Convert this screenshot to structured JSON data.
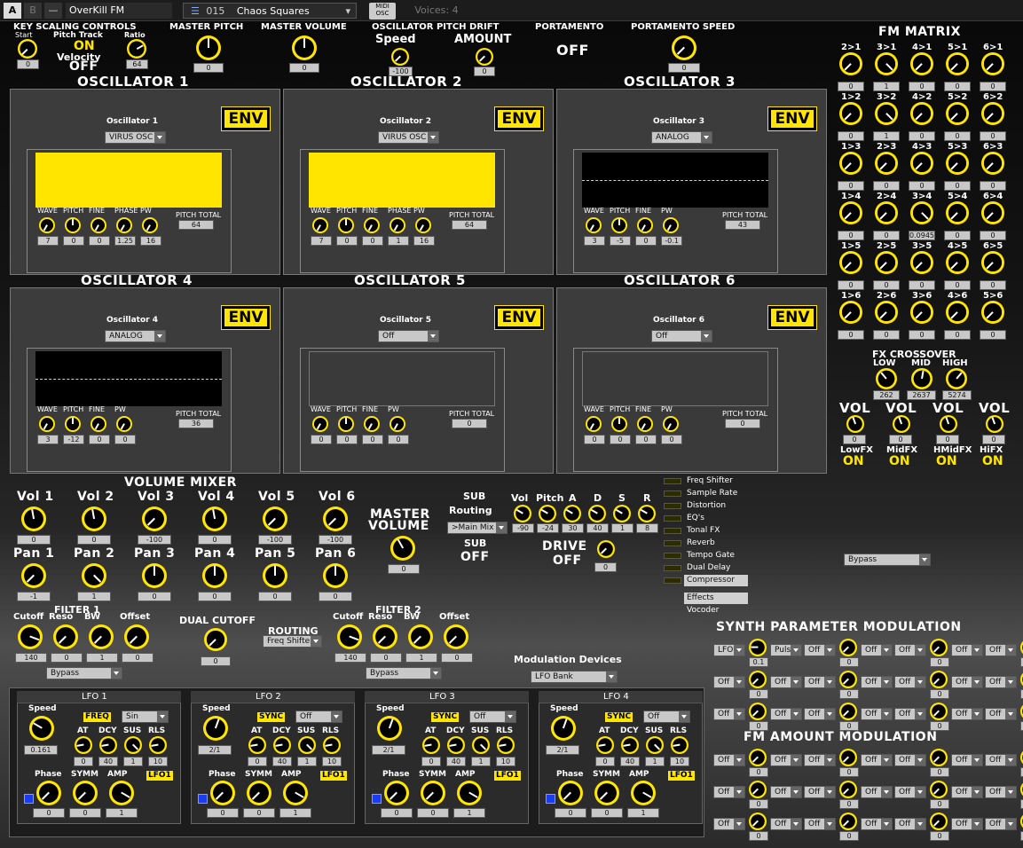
{
  "topbar": {
    "tab_a": "A",
    "tab_b": "B",
    "minus": "—",
    "plugin": "OverKill FM",
    "preset_num": "015",
    "preset_name": "Chaos Squares",
    "midi": "MIDI",
    "osc": "OSC",
    "voices": "Voices: 4"
  },
  "header": {
    "key_scaling": "KEY SCALING CONTROLS",
    "start": "Start",
    "pitch_track": "Pitch Track",
    "ratio": "Ratio",
    "on": "ON",
    "velocity": "Velocity",
    "off": "OFF",
    "start_val": "0",
    "ratio_val": "64",
    "master_pitch": "MASTER PITCH",
    "master_pitch_val": "0",
    "master_volume": "MASTER VOLUME",
    "master_volume_val": "0",
    "drift": "OSCILLATOR PITCH DRIFT",
    "speed": "Speed",
    "amount": "AMOUNT",
    "speed_val": "-100",
    "amount_val": "0",
    "portamento": "PORTAMENTO",
    "portamento_state": "OFF",
    "porta_speed": "PORTAMENTO SPEED",
    "porta_speed_val": "0"
  },
  "osc_labels": {
    "wave": "WAVE",
    "pitch": "PITCH",
    "fine": "FINE",
    "phase": "PHASE",
    "pw": "PW",
    "pitch_total": "PITCH TOTAL",
    "env": "ENV"
  },
  "oscillators": [
    {
      "title": "OSCILLATOR 1",
      "sub": "Oscillator 1",
      "type": "VIRUS OSC",
      "wave": "7",
      "pitch": "0",
      "fine": "0",
      "phase": "1.25",
      "pw": "16",
      "total": "64"
    },
    {
      "title": "OSCILLATOR 2",
      "sub": "Oscillator 2",
      "type": "VIRUS OSC",
      "wave": "7",
      "pitch": "0",
      "fine": "0",
      "phase": "1",
      "pw": "16",
      "total": "64"
    },
    {
      "title": "OSCILLATOR 3",
      "sub": "Oscillator 3",
      "type": "ANALOG",
      "wave": "3",
      "pitch": "-5",
      "fine": "0",
      "pw": "-0.1",
      "total": "43"
    },
    {
      "title": "OSCILLATOR 4",
      "sub": "Oscillator 4",
      "type": "ANALOG",
      "wave": "3",
      "pitch": "-12",
      "fine": "0",
      "pw": "0",
      "total": "36"
    },
    {
      "title": "OSCILLATOR 5",
      "sub": "Oscillator 5",
      "type": "Off",
      "wave": "0",
      "pitch": "0",
      "fine": "0",
      "pw": "0",
      "total": "0"
    },
    {
      "title": "OSCILLATOR 6",
      "sub": "Oscillator 6",
      "type": "Off",
      "wave": "0",
      "pitch": "0",
      "fine": "0",
      "pw": "0",
      "total": "0"
    }
  ],
  "fm_matrix": {
    "title": "FM MATRIX",
    "rows": [
      [
        [
          "2>1",
          "0"
        ],
        [
          "3>1",
          "1"
        ],
        [
          "4>1",
          "0"
        ],
        [
          "5>1",
          "0"
        ],
        [
          "6>1",
          "0"
        ]
      ],
      [
        [
          "1>2",
          "0"
        ],
        [
          "3>2",
          "1"
        ],
        [
          "4>2",
          "0"
        ],
        [
          "5>2",
          "0"
        ],
        [
          "6>2",
          "0"
        ]
      ],
      [
        [
          "1>3",
          "0"
        ],
        [
          "2>3",
          "0"
        ],
        [
          "4>3",
          "0"
        ],
        [
          "5>3",
          "0"
        ],
        [
          "6>3",
          "0"
        ]
      ],
      [
        [
          "1>4",
          "0"
        ],
        [
          "2>4",
          "0"
        ],
        [
          "3>4",
          "0.0945"
        ],
        [
          "5>4",
          "0"
        ],
        [
          "6>4",
          "0"
        ]
      ],
      [
        [
          "1>5",
          "0"
        ],
        [
          "2>5",
          "0"
        ],
        [
          "3>5",
          "0"
        ],
        [
          "4>5",
          "0"
        ],
        [
          "6>5",
          "0"
        ]
      ],
      [
        [
          "1>6",
          "0"
        ],
        [
          "2>6",
          "0"
        ],
        [
          "3>6",
          "0"
        ],
        [
          "4>6",
          "0"
        ],
        [
          "5>6",
          "0"
        ]
      ]
    ]
  },
  "fx_crossover": {
    "title": "FX CROSSOVER",
    "low": "LOW",
    "mid": "MID",
    "high": "HIGH",
    "low_val": "262",
    "mid_val": "2637",
    "high_val": "5274",
    "vol": "VOL",
    "vol_vals": [
      "0",
      "0",
      "0",
      "0"
    ],
    "bands": [
      "LowFX",
      "MidFX",
      "HMidFX",
      "HiFX"
    ],
    "on": "ON"
  },
  "volume_mixer": {
    "title": "VOLUME MIXER",
    "vols": [
      [
        "Vol 1",
        "0"
      ],
      [
        "Vol 2",
        "0"
      ],
      [
        "Vol 3",
        "-100"
      ],
      [
        "Vol 4",
        "0"
      ],
      [
        "Vol 5",
        "-100"
      ],
      [
        "Vol 6",
        "-100"
      ]
    ],
    "pans": [
      [
        "Pan 1",
        "-1"
      ],
      [
        "Pan 2",
        "1"
      ],
      [
        "Pan 3",
        "0"
      ],
      [
        "Pan 4",
        "0"
      ],
      [
        "Pan 5",
        "0"
      ],
      [
        "Pan 6",
        "0"
      ]
    ],
    "master": "MASTER",
    "volume": "VOLUME",
    "master_val": "0"
  },
  "sub": {
    "sub": "SUB",
    "routing": "Routing",
    "routing_val": ">Main Mix",
    "sub2": "SUB",
    "sub_state": "OFF",
    "vol": "Vol",
    "pitch": "Pitch",
    "a": "A",
    "d": "D",
    "s": "S",
    "r": "R",
    "vals": [
      "-90",
      "-24",
      "30",
      "40",
      "1",
      "8"
    ],
    "drive": "DRIVE",
    "drive_state": "OFF",
    "drive_val": "0"
  },
  "fx_list": {
    "items": [
      "Freq Shifter",
      "Sample Rate",
      "Distortion",
      "EQ's",
      "Tonal FX",
      "Reverb",
      "Tempo Gate",
      "Dual Delay",
      "Compressor"
    ],
    "effects": "Effects",
    "vocoder": "Vocoder",
    "bypass": "Bypass"
  },
  "filters": {
    "filter1": "FILTER 1",
    "filter2": "FILTER 2",
    "cutoff": "Cutoff",
    "reso": "Reso",
    "bw": "BW",
    "offset": "Offset",
    "f1_vals": [
      "140",
      "0",
      "1",
      "0"
    ],
    "f2_vals": [
      "140",
      "0",
      "1",
      "0"
    ],
    "bypass1": "Bypass",
    "bypass2": "Bypass",
    "dual_cutoff": "DUAL CUTOFF",
    "dual_val": "0",
    "routing": "ROUTING",
    "routing_val": "Freq Shifter"
  },
  "mod_devices": {
    "label": "Modulation Devices",
    "value": "LFO Bank"
  },
  "lfos": [
    {
      "title": "LFO 1",
      "speed": "Speed",
      "speed_val": "0.161",
      "mode": "FREQ",
      "wave": "Sin",
      "at": "AT",
      "dcy": "DCY",
      "sus": "SUS",
      "rls": "RLS",
      "env_vals": [
        "0",
        "40",
        "1",
        "10"
      ],
      "phase": "Phase",
      "symm": "SYMM",
      "amp": "AMP",
      "tag": "LFO1",
      "bottom": [
        "0",
        "0",
        "1"
      ]
    },
    {
      "title": "LFO 2",
      "speed": "Speed",
      "speed_val": "2/1",
      "mode": "SYNC",
      "wave": "Off",
      "at": "AT",
      "dcy": "DCY",
      "sus": "SUS",
      "rls": "RLS",
      "env_vals": [
        "0",
        "40",
        "1",
        "10"
      ],
      "phase": "Phase",
      "symm": "SYMM",
      "amp": "AMP",
      "tag": "LFO1",
      "bottom": [
        "0",
        "0",
        "1"
      ]
    },
    {
      "title": "LFO 3",
      "speed": "Speed",
      "speed_val": "2/1",
      "mode": "SYNC",
      "wave": "Off",
      "at": "AT",
      "dcy": "DCY",
      "sus": "SUS",
      "rls": "RLS",
      "env_vals": [
        "0",
        "40",
        "1",
        "10"
      ],
      "phase": "Phase",
      "symm": "SYMM",
      "amp": "AMP",
      "tag": "LFO1",
      "bottom": [
        "0",
        "0",
        "1"
      ]
    },
    {
      "title": "LFO 4",
      "speed": "Speed",
      "speed_val": "2/1",
      "mode": "SYNC",
      "wave": "Off",
      "at": "AT",
      "dcy": "DCY",
      "sus": "SUS",
      "rls": "RLS",
      "env_vals": [
        "0",
        "40",
        "1",
        "10"
      ],
      "phase": "Phase",
      "symm": "SYMM",
      "amp": "AMP",
      "tag": "LFO1",
      "bottom": [
        "0",
        "0",
        "1"
      ]
    }
  ],
  "synth_mod": {
    "title": "SYNTH PARAMETER MODULATION",
    "rows": [
      [
        [
          "LFO",
          "Pulse",
          "0.1"
        ],
        [
          "Off",
          "Off",
          "0"
        ],
        [
          "Off",
          "Off",
          "0"
        ],
        [
          "Off",
          "",
          "0"
        ]
      ],
      [
        [
          "Off",
          "Off",
          "0"
        ],
        [
          "Off",
          "Off",
          "0"
        ],
        [
          "Off",
          "Off",
          "0"
        ],
        [
          "Off",
          "",
          "0"
        ]
      ],
      [
        [
          "Off",
          "Off",
          "0"
        ],
        [
          "Off",
          "Off",
          "0"
        ],
        [
          "Off",
          "Off",
          "0"
        ],
        [
          "Off",
          "",
          "0"
        ]
      ]
    ]
  },
  "fm_mod": {
    "title": "FM AMOUNT MODULATION",
    "rows": [
      [
        [
          "Off",
          "Off",
          "0"
        ],
        [
          "Off",
          "Off",
          "0"
        ],
        [
          "Off",
          "Off",
          "0"
        ],
        [
          "Off",
          "",
          "0"
        ]
      ],
      [
        [
          "Off",
          "Off",
          "0"
        ],
        [
          "Off",
          "Off",
          "0"
        ],
        [
          "Off",
          "Off",
          "0"
        ],
        [
          "Off",
          "",
          "0"
        ]
      ],
      [
        [
          "Off",
          "Off",
          "0"
        ],
        [
          "Off",
          "Off",
          "0"
        ],
        [
          "Off",
          "Off",
          "0"
        ],
        [
          "Off",
          "",
          "0"
        ]
      ]
    ]
  }
}
